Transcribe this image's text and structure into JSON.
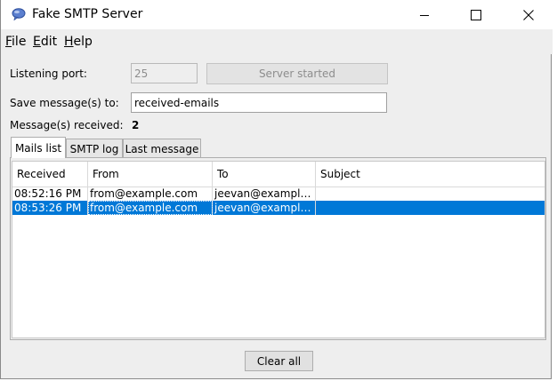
{
  "window": {
    "title": "Fake SMTP Server",
    "accent": "#0078d7"
  },
  "menu": {
    "items": [
      {
        "mnemonic": "F",
        "rest": "ile"
      },
      {
        "mnemonic": "E",
        "rest": "dit"
      },
      {
        "mnemonic": "H",
        "rest": "elp"
      }
    ]
  },
  "form": {
    "port_label": "Listening port:",
    "port_value": "25",
    "server_button": "Server started",
    "save_label": "Save message(s) to:",
    "save_value": "received-emails",
    "received_label": "Message(s) received:",
    "received_count": "2"
  },
  "tabs": [
    "Mails list",
    "SMTP log",
    "Last message"
  ],
  "table": {
    "columns": [
      "Received",
      "From",
      "To",
      "Subject"
    ],
    "rows": [
      {
        "received": "08:52:16 PM",
        "from": "from@example.com",
        "to": "jeevan@example...",
        "subject": "",
        "selected": false
      },
      {
        "received": "08:53:26 PM",
        "from": "from@example.com",
        "to": "jeevan@example...",
        "subject": "",
        "selected": true
      }
    ]
  },
  "footer": {
    "clear_button": "Clear all"
  },
  "icons": {
    "app": "chat-bubble-icon",
    "minimize": "minimize-icon",
    "maximize": "maximize-icon",
    "close": "close-icon"
  }
}
